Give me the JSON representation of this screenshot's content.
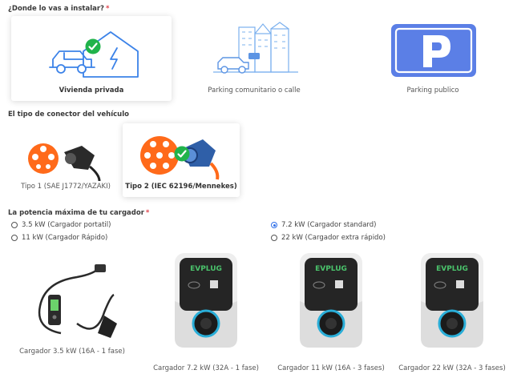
{
  "installation": {
    "question": "¿Donde lo vas a instalar?",
    "required_mark": "*",
    "options": [
      {
        "label": "Vivienda privada",
        "icon": "house-car-icon",
        "selected": true
      },
      {
        "label": "Parking comunitario o calle",
        "icon": "building-car-icon",
        "selected": false
      },
      {
        "label": "Parking publico",
        "icon": "parking-sign-icon",
        "selected": false
      }
    ]
  },
  "connector": {
    "question": "El tipo de conector del vehículo",
    "options": [
      {
        "label": "Tipo 1 (SAE J1772/YAZAKI)",
        "icon": "type1-connector-icon",
        "selected": false
      },
      {
        "label": "Tipo 2 (IEC 62196/Mennekes)",
        "icon": "type2-connector-icon",
        "selected": true
      }
    ]
  },
  "power": {
    "question": "La potencia máxima de tu cargador",
    "required_mark": "*",
    "options": [
      {
        "label": "3.5 kW (Cargador portatil)",
        "selected": false
      },
      {
        "label": "7.2 kW (Cargador standard)",
        "selected": true
      },
      {
        "label": "11 kW (Cargador Rápido)",
        "selected": false
      },
      {
        "label": "22 kW (Cargador extra rápido)",
        "selected": false
      }
    ]
  },
  "chargers": [
    {
      "label": "Cargador 3.5 kW (16A - 1 fase)",
      "image": "portable-charger-cable"
    },
    {
      "label": "Cargador 7.2 kW (32A - 1 fase)",
      "image": "wallbox-charger",
      "brand": "EVPLUG"
    },
    {
      "label": "Cargador 11 kW (16A - 3 fases)",
      "image": "wallbox-charger",
      "brand": "EVPLUG"
    },
    {
      "label": "Cargador 22 kW (32A - 3 fases)",
      "image": "wallbox-charger",
      "brand": "EVPLUG"
    }
  ],
  "colors": {
    "accent_blue": "#2f6fe8",
    "icon_blue": "#3b82e8",
    "parking_blue": "#5b7fe6",
    "check_green": "#21b34b",
    "connector_orange": "#ff6a1a",
    "required_red": "#e0434b"
  }
}
